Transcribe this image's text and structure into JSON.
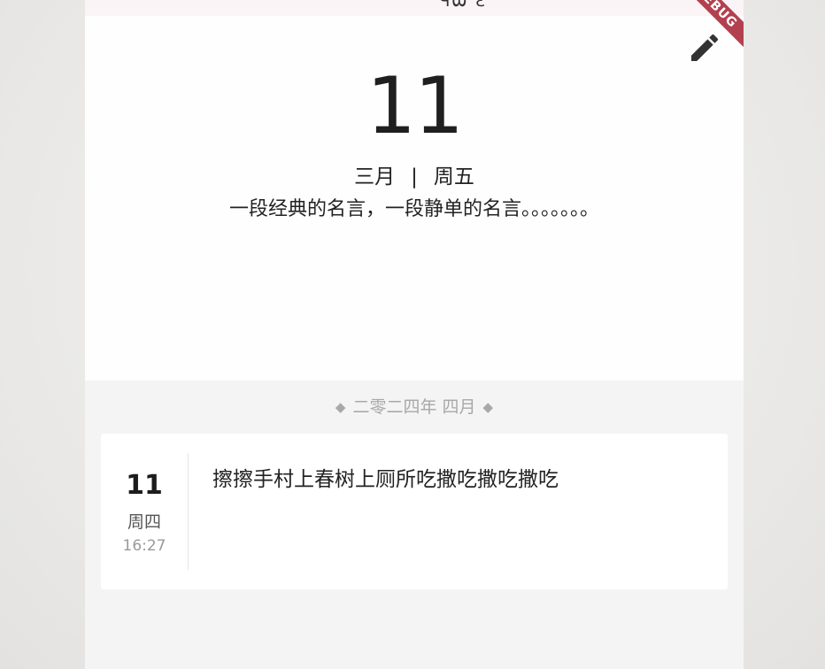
{
  "status_bar": {
    "text": "ЧѾ Ɛ"
  },
  "debug_banner": "DEBUG",
  "header": {
    "day": "11",
    "month": "三月",
    "separator": "|",
    "weekday": "周五",
    "quote": "一段经典的名言，一段静单的名言。。。。。。。",
    "edit_icon": "pencil-icon"
  },
  "section": {
    "diamond_left": "◆",
    "label": "二零二四年 四月",
    "diamond_right": "◆"
  },
  "entries": [
    {
      "day": "11",
      "weekday": "周四",
      "time": "16:27",
      "text": "擦擦手村上春树上厕所吃撒吃撒吃撒吃"
    }
  ],
  "colors": {
    "banner": "#b3404f",
    "header_bg": "#fefefe",
    "page_bg": "#f4f4f4",
    "section_text": "#a8a8a8"
  }
}
